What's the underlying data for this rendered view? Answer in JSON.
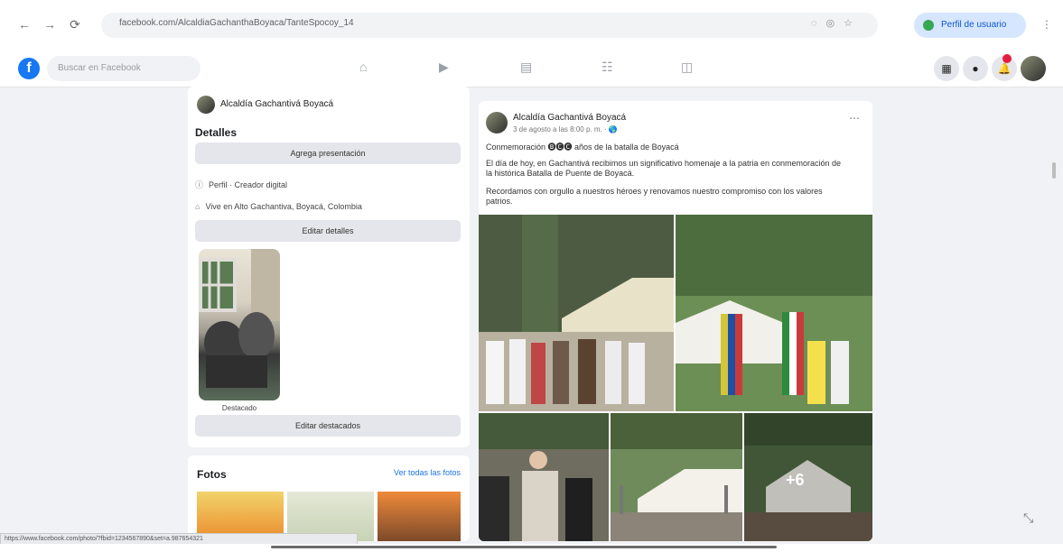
{
  "browser": {
    "url": "facebook.com/AlcaldiaGachanthaBoyaca/TanteSpocoy_14",
    "profile_label": "Perfil de usuario"
  },
  "facebook": {
    "search_placeholder": "Buscar en Facebook"
  },
  "left_panel": {
    "page_name": "Alcaldía Gachantivá Boyacá",
    "section_title": "Detalles",
    "button_presentation": "Agrega presentación",
    "detail_profile": "Perfil · Creador digital",
    "detail_location": "Vive en Alto Gachantiva, Boyacá, Colombia",
    "button_edit_details": "Editar detalles",
    "featured_label": "Destacado",
    "button_edit_featured": "Editar destacados"
  },
  "photos": {
    "title": "Fotos",
    "see_all": "Ver todas las fotos"
  },
  "post": {
    "author": "Alcaldía Gachantivá Boyacá",
    "time": "3 de agosto a las 8:00 p. m. · 🌎",
    "line1": "Conmemoración 🅑🅒🅒 años de la batalla de Boyacá",
    "line2a": "El día de hoy, en Gachantivá recibimos un significativo homenaje a la patria en conmemoración de",
    "line2b": "la histórica Batalla de Puente de Boyacá.",
    "line3a": "Recordamos con orgullo a nuestros héroes y renovamos nuestro compromiso con los valores",
    "line3b": "patrios.",
    "more_count": "+6"
  },
  "status_url": "https://www.facebook.com/photo/?fbid=1234567890&set=a.987654321"
}
